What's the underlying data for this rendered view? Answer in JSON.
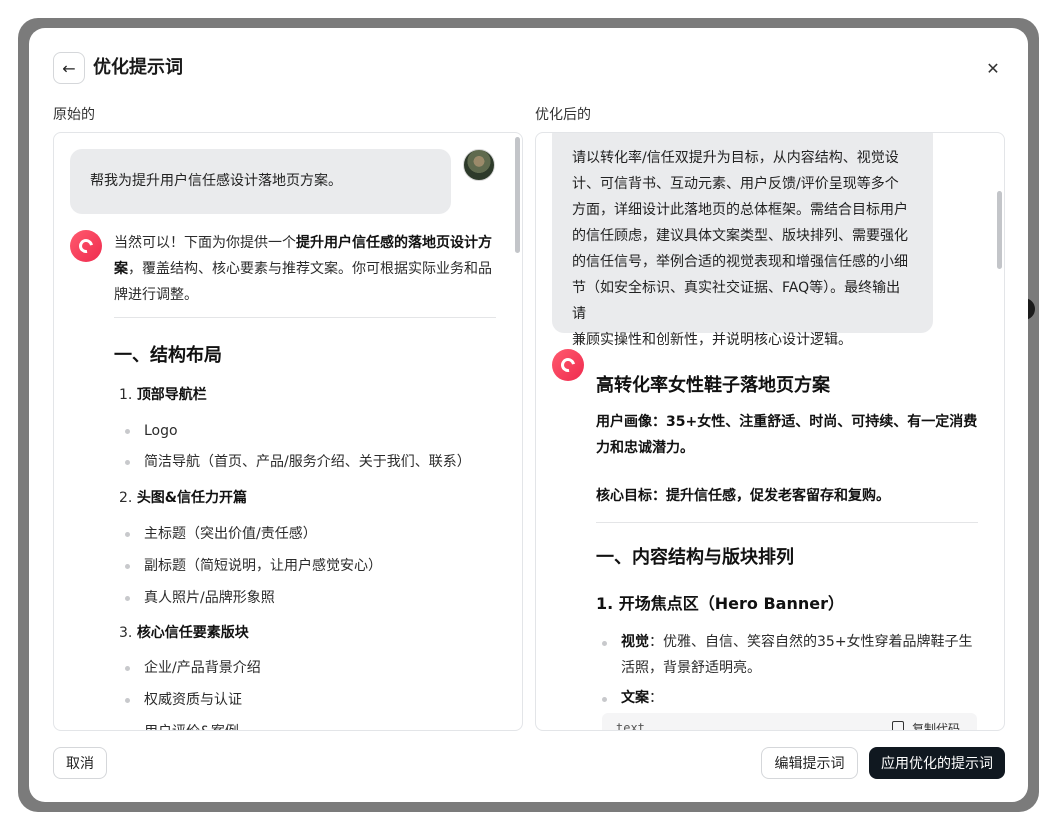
{
  "dialog": {
    "title": "优化提示词",
    "back_icon": "arrow-left-icon",
    "close_icon": "close-icon"
  },
  "left": {
    "label": "原始的",
    "user_message": "帮我为提升用户信任感设计落地页方案。",
    "ai_intro": {
      "part1": "当然可以！下面为你提供一个",
      "bold1": "提升用户信任感的落地页设计方",
      "bold2": "案",
      "part2": "，覆盖结构、核心要素与推荐文案。你可根据实际业务和品",
      "part3": "牌进行调整。"
    },
    "heading": "一、结构布局",
    "sections": [
      {
        "num": "1.",
        "title": "顶部导航栏",
        "items": [
          "Logo",
          "简洁导航（首页、产品/服务介绍、关于我们、联系）"
        ]
      },
      {
        "num": "2.",
        "title": "头图&信任力开篇",
        "items": [
          "主标题（突出价值/责任感）",
          "副标题（简短说明，让用户感觉安心）",
          "真人照片/品牌形象照"
        ]
      },
      {
        "num": "3.",
        "title": "核心信任要素版块",
        "items": [
          "企业/产品背景介绍",
          "权威资质与认证",
          "用户评价&案例"
        ]
      }
    ]
  },
  "right": {
    "label": "优化后的",
    "prompt_lines": [
      "请以转化率/信任双提升为目标，从内容结构、视觉设",
      "计、可信背书、互动元素、用户反馈/评价呈现等多个",
      "方面，详细设计此落地页的总体框架。需结合目标用户",
      "的信任顾虑，建议具体文案类型、版块排列、需要强化",
      "的信任信号，举例合适的视觉表现和增强信任感的小细",
      "节（如安全标识、真实社交证据、FAQ等）。最终输出请",
      "兼顾实操性和创新性，并说明核心设计逻辑。"
    ],
    "answer_title": "高转化率女性鞋子落地页方案",
    "persona_line1": "用户画像：35+女性、注重舒适、时尚、可持续、有一定消费",
    "persona_line2": "力和忠诚潜力。",
    "goal": "核心目标：提升信任感，促发老客留存和复购。",
    "heading": "一、内容结构与版块排列",
    "subheading": "1. 开场焦点区（Hero Banner）",
    "visual_label": "视觉",
    "visual_line1": "：优雅、自信、笑容自然的35+女性穿着品牌鞋子生",
    "visual_line2": "活照，背景舒适明亮。",
    "copy_label_title": "文案",
    "copy_colon": "：",
    "code_lang": "text",
    "copy_code": "复制代码"
  },
  "footer": {
    "cancel": "取消",
    "edit": "编辑提示词",
    "apply": "应用优化的提示词"
  }
}
